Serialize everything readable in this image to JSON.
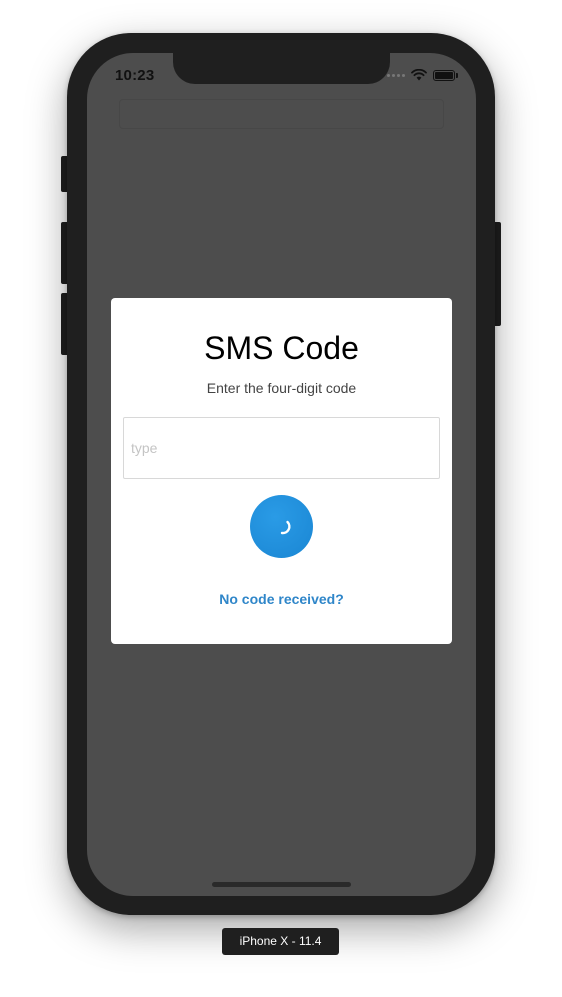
{
  "status_bar": {
    "time": "10:23",
    "signal_icon": "signal-dots-icon",
    "wifi_icon": "wifi-icon",
    "battery_icon": "battery-icon"
  },
  "modal": {
    "title": "SMS Code",
    "subtitle": "Enter the four-digit code",
    "input": {
      "value": "",
      "placeholder": "type"
    },
    "submit_button": {
      "icon": "loading-spinner-icon",
      "color": "#1a86d3"
    },
    "resend_link": "No code received?",
    "link_color": "#2f86c9"
  },
  "screen": {
    "background": "#4d4d4d"
  },
  "device_label": "iPhone X - 11.4"
}
